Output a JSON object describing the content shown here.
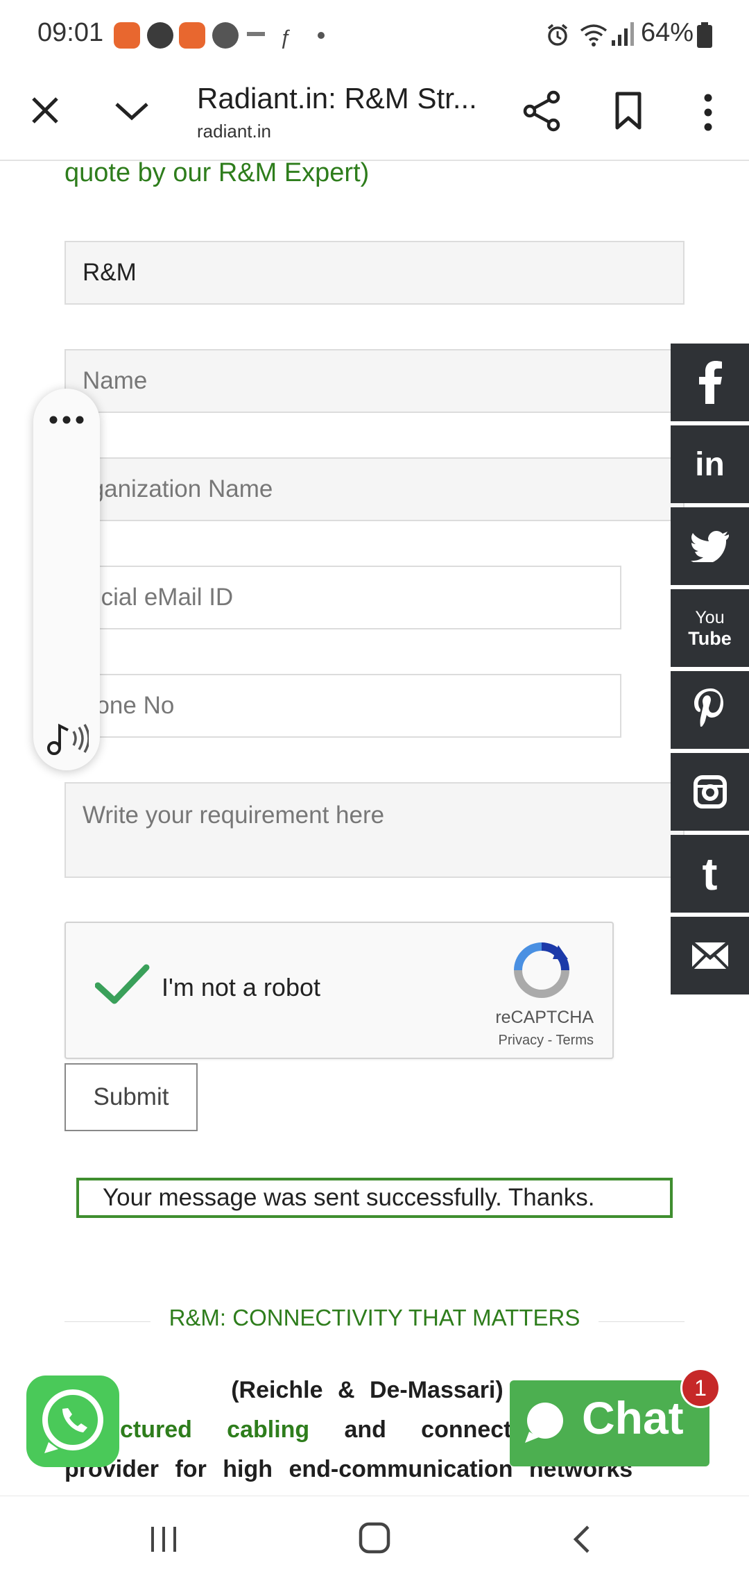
{
  "status_bar": {
    "time": "09:01",
    "battery": "64%",
    "notification_icons": [
      "apollo-247-icon",
      "facebook-icon",
      "apollo-247-icon",
      "e-app-icon",
      "rapido-icon",
      "flipkart-icon",
      "dot-icon"
    ],
    "status_icons": [
      "alarm-icon",
      "wifi-icon",
      "signal-icon",
      "battery-icon"
    ]
  },
  "browser": {
    "title": "Radiant.in: R&M Str...",
    "url": "radiant.in",
    "actions": [
      "close-icon",
      "chevron-down-icon",
      "share-icon",
      "bookmark-icon",
      "more-vertical-icon"
    ]
  },
  "form": {
    "intro_tail": "quote by our R&M Expert)",
    "product_value": "R&M",
    "name_placeholder": "Name",
    "org_placeholder": "rganization Name",
    "email_placeholder": "fficial eMail ID",
    "phone_placeholder": "hone No",
    "requirement_placeholder": "Write your requirement here",
    "captcha": {
      "label": "I'm not a robot",
      "brand": "reCAPTCHA",
      "privacy": "Privacy",
      "separator": "-",
      "terms": "Terms"
    },
    "submit_label": "Submit",
    "success_message": "Your message was sent successfully. Thanks."
  },
  "section": {
    "heading": "R&M: CONNECTIVITY THAT MATTERS",
    "line1_start": "",
    "line1_bold": "(Reichle & De-Massari) is a l",
    "line2_link1": "ctured",
    "line2_link2": "cabling",
    "line2_and": "and",
    "line2_conn": "connecti",
    "line3": "provider for high end-communication networks"
  },
  "social": [
    "facebook-icon",
    "linkedin-icon",
    "twitter-icon",
    "youtube-icon",
    "pinterest-icon",
    "instagram-icon",
    "tumblr-icon",
    "mail-icon"
  ],
  "social_text": {
    "linkedin": "in",
    "youtube_top": "You",
    "youtube_bottom": "Tube",
    "tumblr": "t"
  },
  "chat": {
    "label": "Chat",
    "badge": "1"
  },
  "colors": {
    "accent_green": "#2e7d1c",
    "social_bg": "#2f3236",
    "chat_green": "#4caf50",
    "whatsapp_green": "#4ac959",
    "badge_red": "#c62828"
  }
}
